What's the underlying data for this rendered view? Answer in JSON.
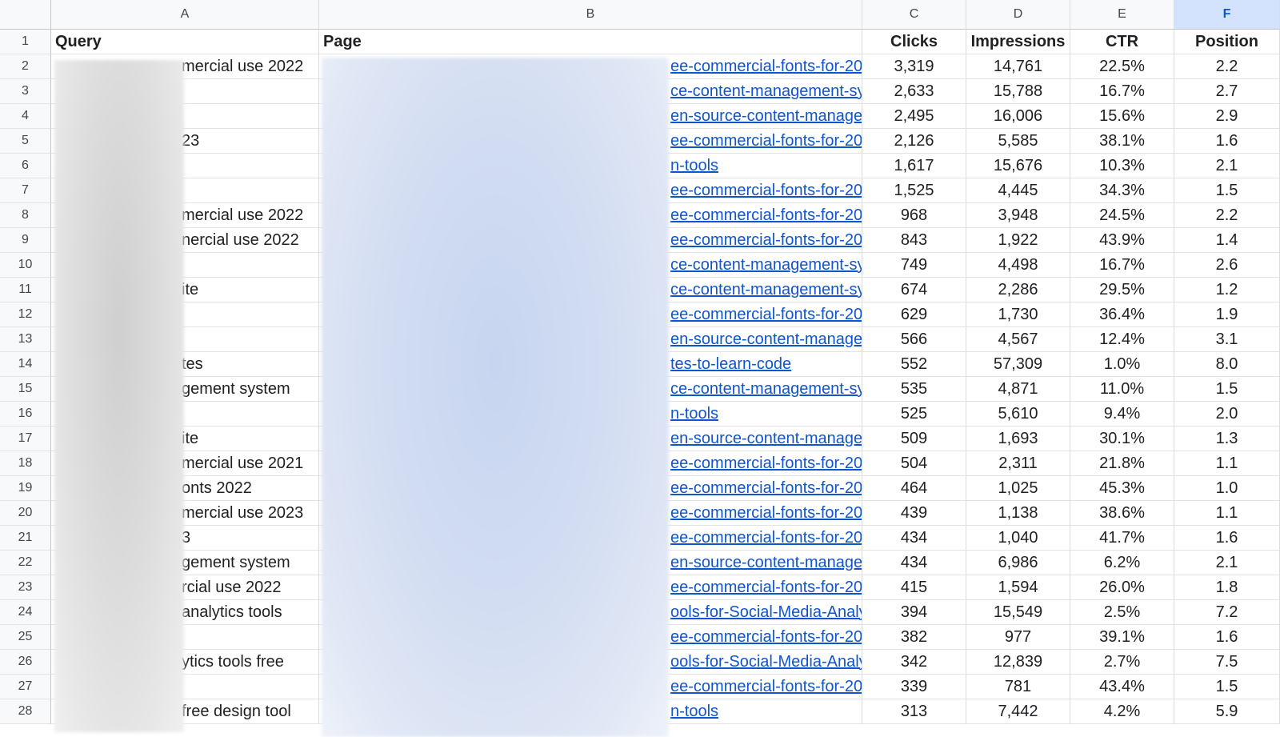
{
  "columns": [
    "A",
    "B",
    "C",
    "D",
    "E",
    "F"
  ],
  "selected_column": "F",
  "header": {
    "row_number": "1",
    "query": "Query",
    "page": "Page",
    "clicks": "Clicks",
    "impressions": "Impressions",
    "ctr": "CTR",
    "position": "Position"
  },
  "rows": [
    {
      "n": "2",
      "query": "mercial use 2022",
      "page": "ee-commercial-fonts-for-202",
      "clicks": "3,319",
      "impressions": "14,761",
      "ctr": "22.5%",
      "position": "2.2"
    },
    {
      "n": "3",
      "query": "",
      "page": "ce-content-management-sy",
      "clicks": "2,633",
      "impressions": "15,788",
      "ctr": "16.7%",
      "position": "2.7"
    },
    {
      "n": "4",
      "query": "",
      "page": "en-source-content-manage",
      "clicks": "2,495",
      "impressions": "16,006",
      "ctr": "15.6%",
      "position": "2.9"
    },
    {
      "n": "5",
      "query": "23",
      "page": "ee-commercial-fonts-for-202",
      "clicks": "2,126",
      "impressions": "5,585",
      "ctr": "38.1%",
      "position": "1.6"
    },
    {
      "n": "6",
      "query": "",
      "page": "n-tools",
      "clicks": "1,617",
      "impressions": "15,676",
      "ctr": "10.3%",
      "position": "2.1"
    },
    {
      "n": "7",
      "query": "",
      "page": "ee-commercial-fonts-for-202",
      "clicks": "1,525",
      "impressions": "4,445",
      "ctr": "34.3%",
      "position": "1.5"
    },
    {
      "n": "8",
      "query": "mercial use 2022",
      "page": "ee-commercial-fonts-for-202",
      "clicks": "968",
      "impressions": "3,948",
      "ctr": "24.5%",
      "position": "2.2"
    },
    {
      "n": "9",
      "query": "nercial use 2022",
      "page": "ee-commercial-fonts-for-202",
      "clicks": "843",
      "impressions": "1,922",
      "ctr": "43.9%",
      "position": "1.4"
    },
    {
      "n": "10",
      "query": "",
      "page": "ce-content-management-sy",
      "clicks": "749",
      "impressions": "4,498",
      "ctr": "16.7%",
      "position": "2.6"
    },
    {
      "n": "11",
      "query": "ite",
      "page": "ce-content-management-sy",
      "clicks": "674",
      "impressions": "2,286",
      "ctr": "29.5%",
      "position": "1.2"
    },
    {
      "n": "12",
      "query": "",
      "page": "ee-commercial-fonts-for-202",
      "clicks": "629",
      "impressions": "1,730",
      "ctr": "36.4%",
      "position": "1.9"
    },
    {
      "n": "13",
      "query": "",
      "page": "en-source-content-manage",
      "clicks": "566",
      "impressions": "4,567",
      "ctr": "12.4%",
      "position": "3.1"
    },
    {
      "n": "14",
      "query": "tes",
      "page": "tes-to-learn-code",
      "clicks": "552",
      "impressions": "57,309",
      "ctr": "1.0%",
      "position": "8.0"
    },
    {
      "n": "15",
      "query": "gement system",
      "page": "ce-content-management-sy",
      "clicks": "535",
      "impressions": "4,871",
      "ctr": "11.0%",
      "position": "1.5"
    },
    {
      "n": "16",
      "query": "",
      "page": "n-tools",
      "clicks": "525",
      "impressions": "5,610",
      "ctr": "9.4%",
      "position": "2.0"
    },
    {
      "n": "17",
      "query": "ite",
      "page": "en-source-content-manage",
      "clicks": "509",
      "impressions": "1,693",
      "ctr": "30.1%",
      "position": "1.3"
    },
    {
      "n": "18",
      "query": "mercial use 2021",
      "page": "ee-commercial-fonts-for-202",
      "clicks": "504",
      "impressions": "2,311",
      "ctr": "21.8%",
      "position": "1.1"
    },
    {
      "n": "19",
      "query": "onts 2022",
      "page": "ee-commercial-fonts-for-202",
      "clicks": "464",
      "impressions": "1,025",
      "ctr": "45.3%",
      "position": "1.0"
    },
    {
      "n": "20",
      "query": "mercial use 2023",
      "page": "ee-commercial-fonts-for-202",
      "clicks": "439",
      "impressions": "1,138",
      "ctr": "38.6%",
      "position": "1.1"
    },
    {
      "n": "21",
      "query": "3",
      "page": "ee-commercial-fonts-for-202",
      "clicks": "434",
      "impressions": "1,040",
      "ctr": "41.7%",
      "position": "1.6"
    },
    {
      "n": "22",
      "query": "gement system",
      "page": "en-source-content-manage",
      "clicks": "434",
      "impressions": "6,986",
      "ctr": "6.2%",
      "position": "2.1"
    },
    {
      "n": "23",
      "query": "rcial use 2022",
      "page": "ee-commercial-fonts-for-202",
      "clicks": "415",
      "impressions": "1,594",
      "ctr": "26.0%",
      "position": "1.8"
    },
    {
      "n": "24",
      "query": "analytics tools",
      "page": "ools-for-Social-Media-Analy",
      "clicks": "394",
      "impressions": "15,549",
      "ctr": "2.5%",
      "position": "7.2"
    },
    {
      "n": "25",
      "query": "",
      "page": "ee-commercial-fonts-for-202",
      "clicks": "382",
      "impressions": "977",
      "ctr": "39.1%",
      "position": "1.6"
    },
    {
      "n": "26",
      "query": "ytics tools free",
      "page": "ools-for-Social-Media-Analy",
      "clicks": "342",
      "impressions": "12,839",
      "ctr": "2.7%",
      "position": "7.5"
    },
    {
      "n": "27",
      "query": "",
      "page": "ee-commercial-fonts-for-202",
      "clicks": "339",
      "impressions": "781",
      "ctr": "43.4%",
      "position": "1.5"
    },
    {
      "n": "28",
      "query": "free design tool",
      "page": "n-tools",
      "clicks": "313",
      "impressions": "7,442",
      "ctr": "4.2%",
      "position": "5.9"
    }
  ]
}
